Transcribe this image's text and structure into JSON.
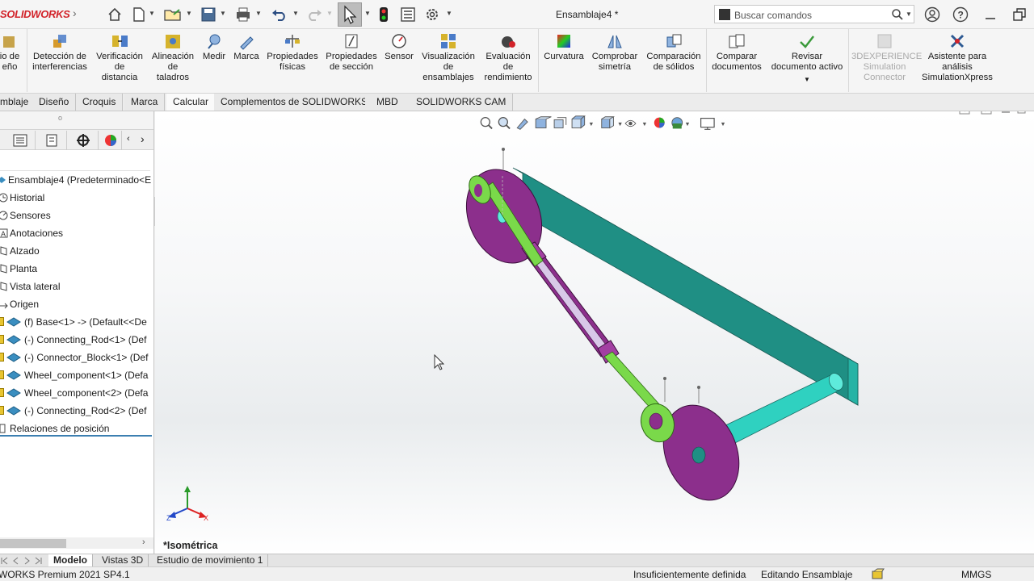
{
  "app": {
    "logo": "SOLIDWORKS",
    "document_title": "Ensamblaje4 *"
  },
  "search": {
    "placeholder": "Buscar comandos"
  },
  "ribbon": {
    "items": [
      {
        "label": "io de\neño"
      },
      {
        "label": "Detección de\ninterferencias"
      },
      {
        "label": "Verificación\nde\ndistancia"
      },
      {
        "label": "Alineación\nde\ntaladros"
      },
      {
        "label": "Medir"
      },
      {
        "label": "Marca"
      },
      {
        "label": "Propiedades\nfísicas"
      },
      {
        "label": "Propiedades\nde sección"
      },
      {
        "label": "Sensor"
      },
      {
        "label": "Visualización\nde\nensamblajes"
      },
      {
        "label": "Evaluación\nde\nrendimiento"
      },
      {
        "label": "Curvatura"
      },
      {
        "label": "Comprobar\nsimetría"
      },
      {
        "label": "Comparación\nde sólidos"
      },
      {
        "label": "Comparar\ndocumentos"
      },
      {
        "label": "Revisar\ndocumento activo"
      },
      {
        "label": "3DEXPERIENCE\nSimulation\nConnector"
      },
      {
        "label": "Asistente para\nanálisis\nSimulationXpress"
      }
    ]
  },
  "tabs": [
    {
      "label": "mblaje"
    },
    {
      "label": "Diseño"
    },
    {
      "label": "Croquis"
    },
    {
      "label": "Marca"
    },
    {
      "label": "Calcular"
    },
    {
      "label": "Complementos de SOLIDWORKS"
    },
    {
      "label": "MBD"
    },
    {
      "label": "SOLIDWORKS CAM"
    }
  ],
  "tree": {
    "items": [
      {
        "label": "Ensamblaje4  (Predeterminado<E"
      },
      {
        "label": "Historial"
      },
      {
        "label": "Sensores"
      },
      {
        "label": "Anotaciones"
      },
      {
        "label": "Alzado"
      },
      {
        "label": "Planta"
      },
      {
        "label": "Vista lateral"
      },
      {
        "label": "Origen"
      },
      {
        "label": "(f) Base<1> -> (Default<<De"
      },
      {
        "label": "(-) Connecting_Rod<1> (Def"
      },
      {
        "label": "(-) Connector_Block<1> (Def"
      },
      {
        "label": "Wheel_component<1> (Defa"
      },
      {
        "label": "Wheel_component<2> (Defa"
      },
      {
        "label": "(-) Connecting_Rod<2> (Def"
      },
      {
        "label": "Relaciones de posición"
      }
    ]
  },
  "graphics": {
    "view_name": "*Isométrica"
  },
  "bottom_tabs": [
    {
      "label": "Modelo"
    },
    {
      "label": "Vistas 3D"
    },
    {
      "label": "Estudio de movimiento 1"
    }
  ],
  "status": {
    "product": "WORKS Premium 2021 SP4.1",
    "definition": "Insuficientemente definida",
    "mode": "Editando Ensamblaje",
    "units": "MMGS"
  },
  "colors": {
    "brand": "#d2232a",
    "wheel": "#8c2f8c",
    "rod": "#7ad94a",
    "base": "#2fd1c0",
    "tree_accent": "#3c7fb1"
  }
}
